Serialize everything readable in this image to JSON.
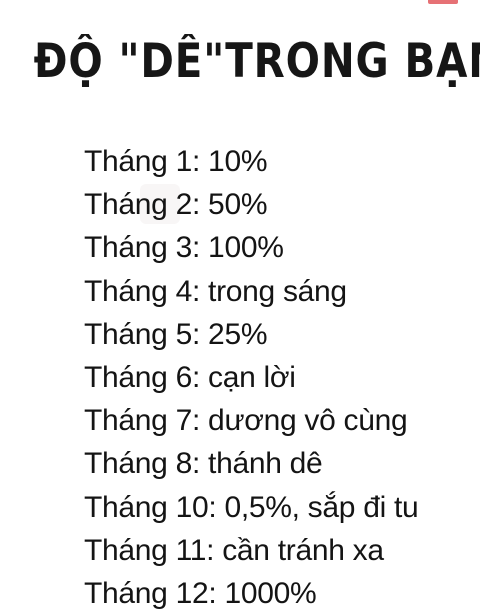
{
  "title": "ĐỘ \"DÊ\"TRONG BẠN",
  "items": [
    "Tháng 1: 10%",
    "Tháng 2: 50%",
    "Tháng 3: 100%",
    "Tháng 4: trong sáng",
    "Tháng 5: 25%",
    "Tháng 6: cạn lời",
    "Tháng 7: dương vô cùng",
    "Tháng 8: thánh dê",
    "Tháng 10: 0,5%, sắp đi tu",
    "Tháng 11: cần tránh xa",
    "Tháng 12: 1000%"
  ]
}
